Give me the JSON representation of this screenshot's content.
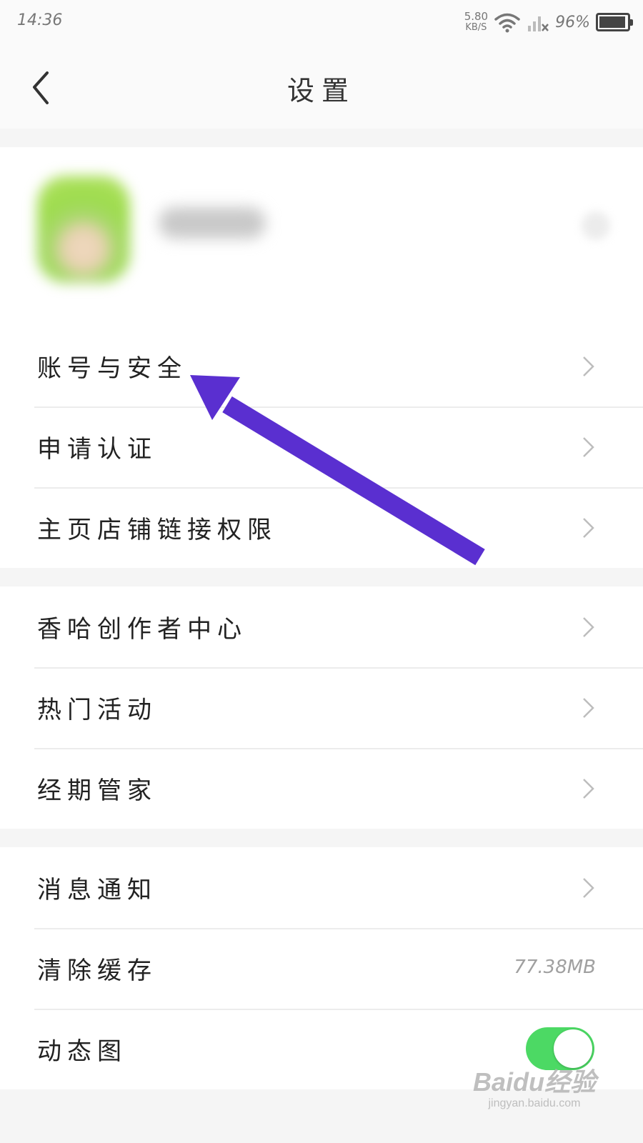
{
  "status_bar": {
    "time": "14:36",
    "net_speed": "5.80",
    "net_unit": "KB/S",
    "battery_percent": "96%",
    "battery_level": 0.96
  },
  "header": {
    "title": "设置",
    "back_icon": "chevron-left-icon"
  },
  "groups": [
    {
      "items": [
        {
          "label": "账号与安全"
        },
        {
          "label": "申请认证"
        },
        {
          "label": "主页店铺链接权限"
        }
      ]
    },
    {
      "items": [
        {
          "label": "香哈创作者中心"
        },
        {
          "label": "热门活动"
        },
        {
          "label": "经期管家"
        }
      ]
    },
    {
      "items": [
        {
          "label": "消息通知"
        },
        {
          "label": "清除缓存",
          "value": "77.38MB"
        },
        {
          "label": "动态图",
          "toggle": true
        }
      ]
    }
  ],
  "colors": {
    "annotation_arrow": "#5a2fd0",
    "toggle_on": "#4cd964",
    "section_gap": "#f5f5f5"
  },
  "watermark": {
    "logo": "Baidu经验",
    "url": "jingyan.baidu.com"
  }
}
